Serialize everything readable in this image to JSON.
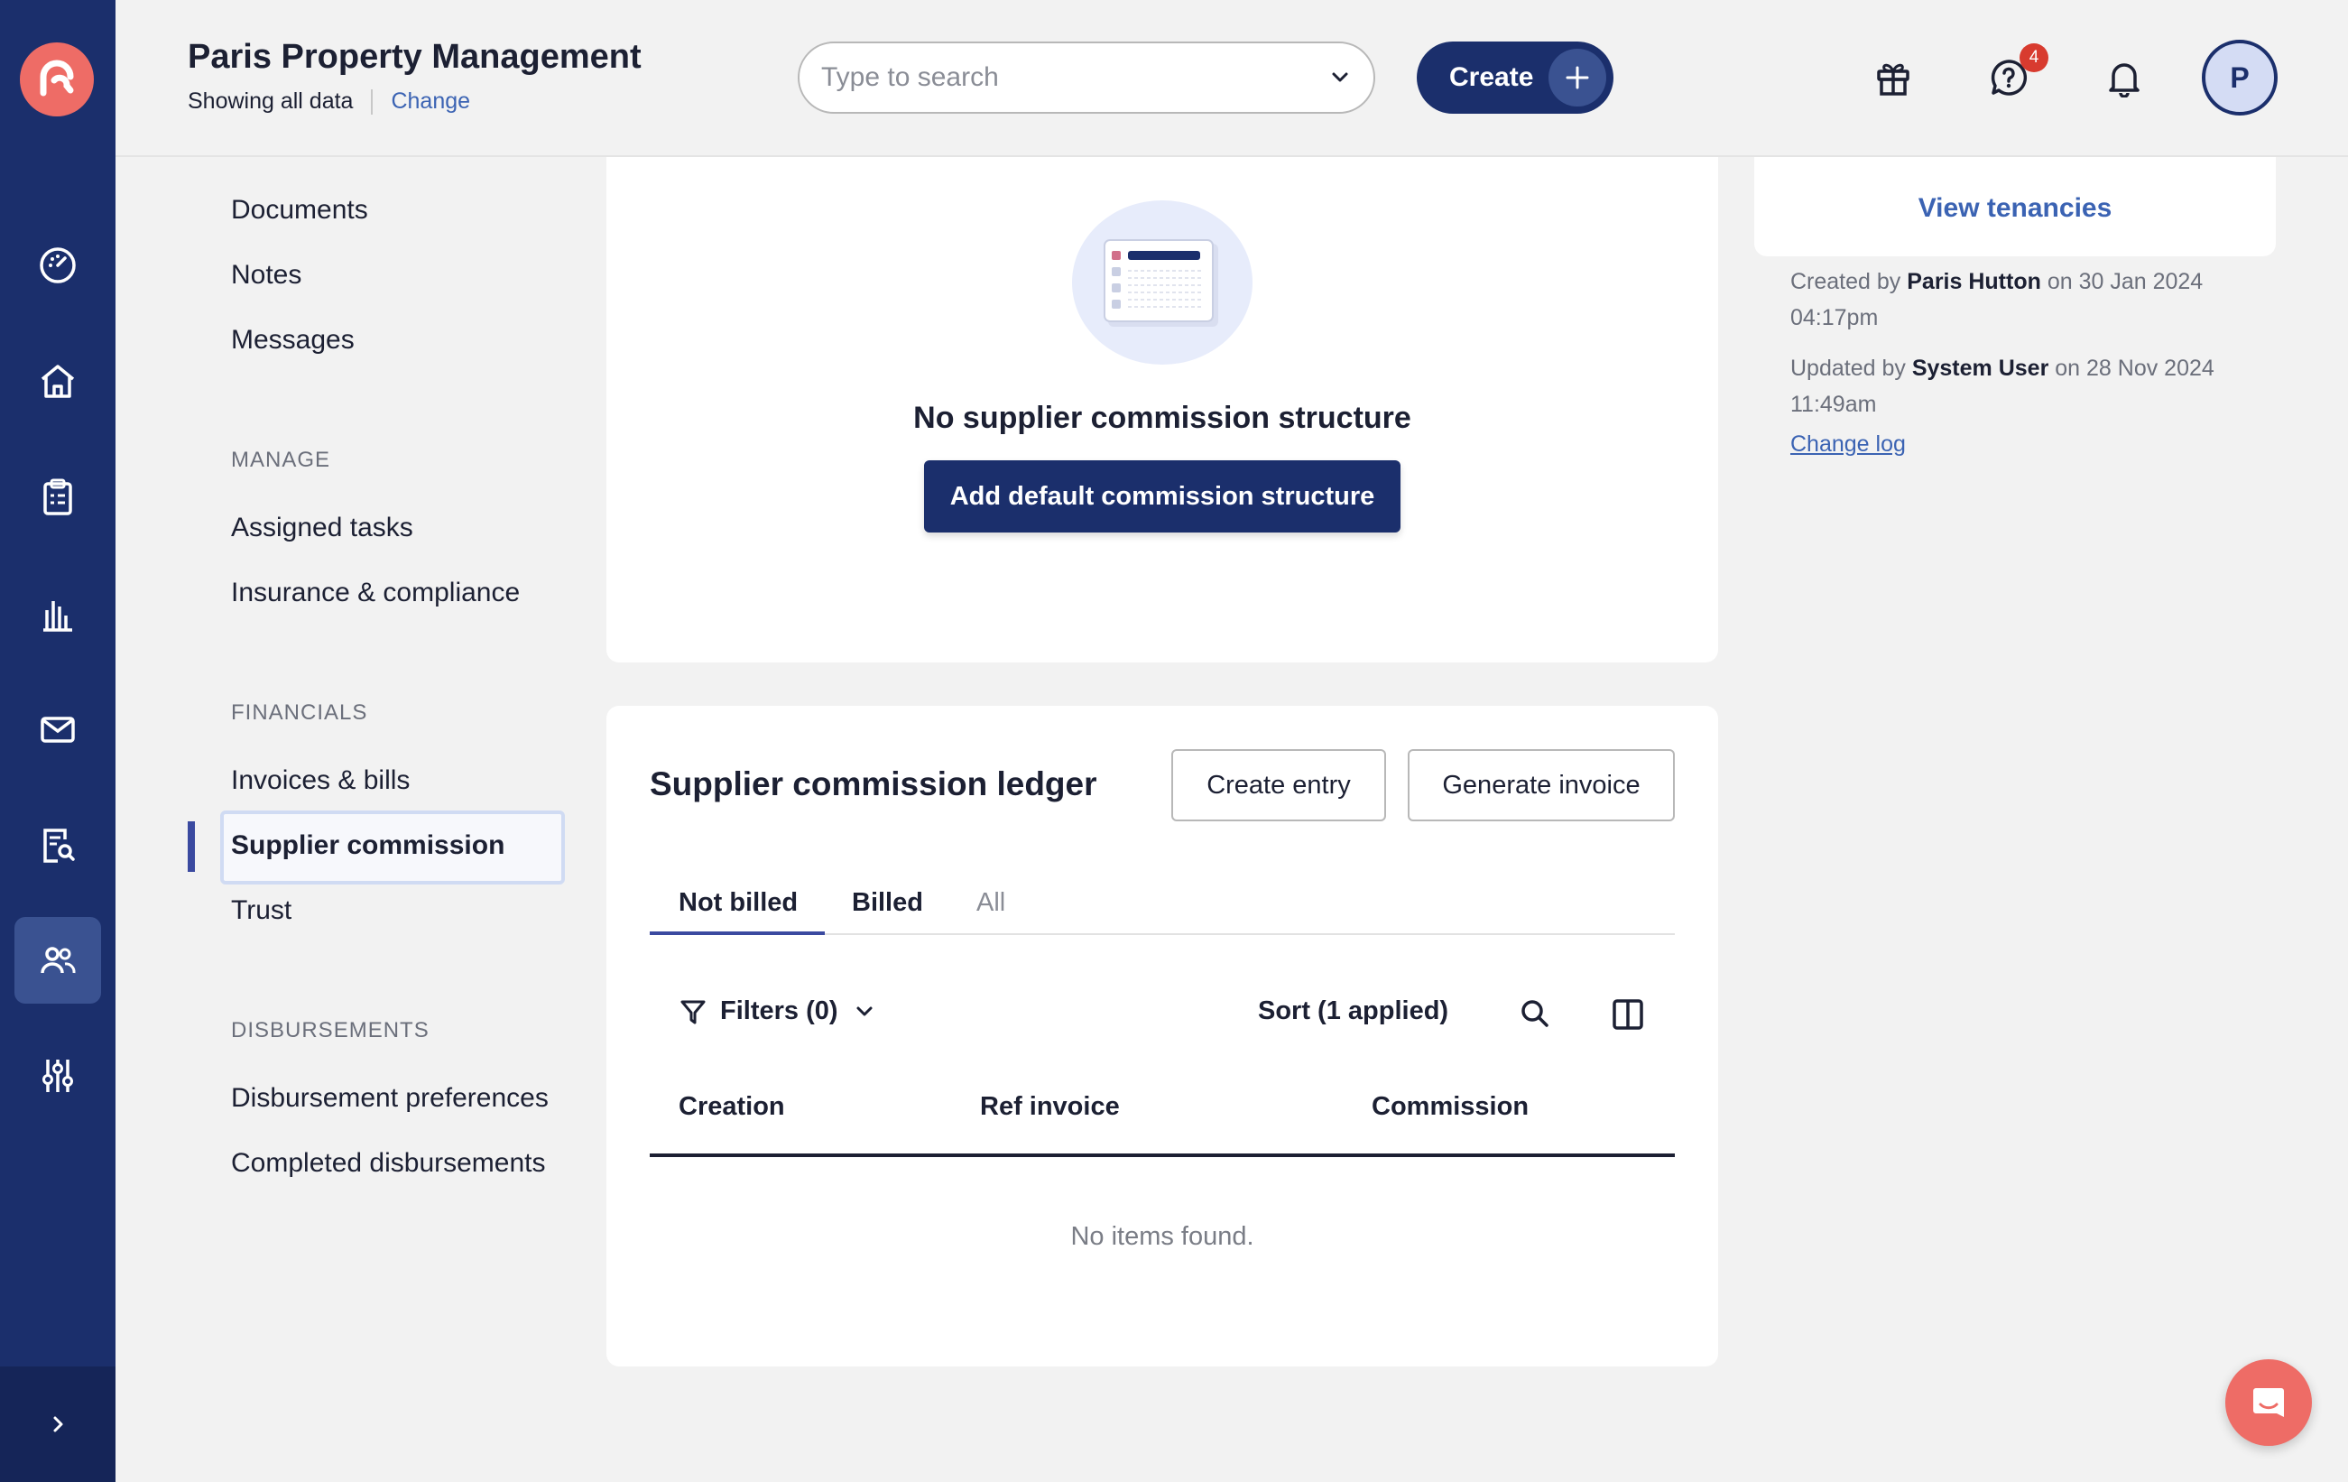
{
  "header": {
    "org_title": "Paris Property Management",
    "showing": "Showing all data",
    "change": "Change",
    "search_placeholder": "Type to search",
    "create_label": "Create",
    "notification_count": "4",
    "avatar_initial": "P"
  },
  "subnav": {
    "top_items": [
      "Documents",
      "Notes",
      "Messages"
    ],
    "manage_heading": "MANAGE",
    "manage_items": [
      "Assigned tasks",
      "Insurance & compliance"
    ],
    "financials_heading": "FINANCIALS",
    "financials_items": [
      "Invoices & bills",
      "Supplier commission",
      "Trust"
    ],
    "disbursements_heading": "DISBURSEMENTS",
    "disbursements_items": [
      "Disbursement preferences",
      "Completed disbursements"
    ]
  },
  "commission_structure": {
    "empty_title": "No supplier commission structure",
    "add_button": "Add default commission structure"
  },
  "ledger": {
    "title": "Supplier commission ledger",
    "create_entry": "Create entry",
    "generate_invoice": "Generate invoice",
    "tabs": [
      "Not billed",
      "Billed",
      "All"
    ],
    "filters": "Filters (0)",
    "sort": "Sort (1 applied)",
    "columns": [
      "Creation",
      "Ref invoice",
      "Commission"
    ],
    "empty": "No items found."
  },
  "right_panel": {
    "view_tenancies": "View tenancies",
    "created_prefix": "Created by",
    "created_by": "Paris Hutton",
    "created_on": "on 30 Jan 2024 04:17pm",
    "updated_prefix": "Updated by",
    "updated_by": "System User",
    "updated_on": "on 28 Nov 2024 11:49am",
    "change_log": "Change log"
  },
  "colors": {
    "navy": "#1b2f6c",
    "accent_coral": "#ee6c66",
    "link_blue": "#3b63b3",
    "badge_red": "#d83b2f"
  }
}
